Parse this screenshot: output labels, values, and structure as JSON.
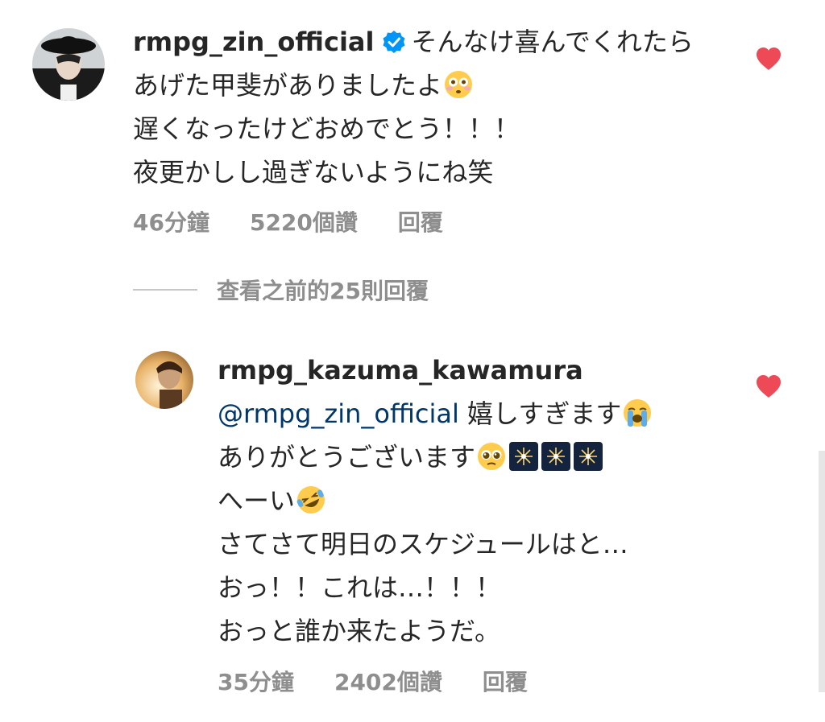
{
  "comment1": {
    "username": "rmpg_zin_official",
    "verified": true,
    "lines": [
      "そんなけ喜んでくれたら",
      "あげた甲斐がありましたよ",
      "遅くなったけどおめでとう！！！",
      "夜更かしし過ぎないようにね笑"
    ],
    "emoji_line2": "flushed-face",
    "time": "46分鐘",
    "likes": "5220個讚",
    "reply_label": "回覆",
    "liked": true
  },
  "view_replies": "查看之前的25則回覆",
  "comment2": {
    "username": "rmpg_kazuma_kawamura",
    "mention": "@rmpg_zin_official",
    "lines": [
      "嬉しすぎます",
      "ありがとうございます",
      "へーい",
      "さてさて明日のスケジュールはと…",
      "おっ！！これは…！！！",
      "おっと誰か来たようだ。"
    ],
    "emoji_line1": "loudly-crying-face",
    "emoji_line2": "pleading-face, fireworks x3",
    "emoji_line3": "rolling-laughing-face",
    "time": "35分鐘",
    "likes": "2402個讚",
    "reply_label": "回覆",
    "liked": true
  },
  "colors": {
    "heart": "#ed4956",
    "verified": "#0095f6",
    "mention": "#00376b",
    "meta": "#8e8e8e"
  }
}
